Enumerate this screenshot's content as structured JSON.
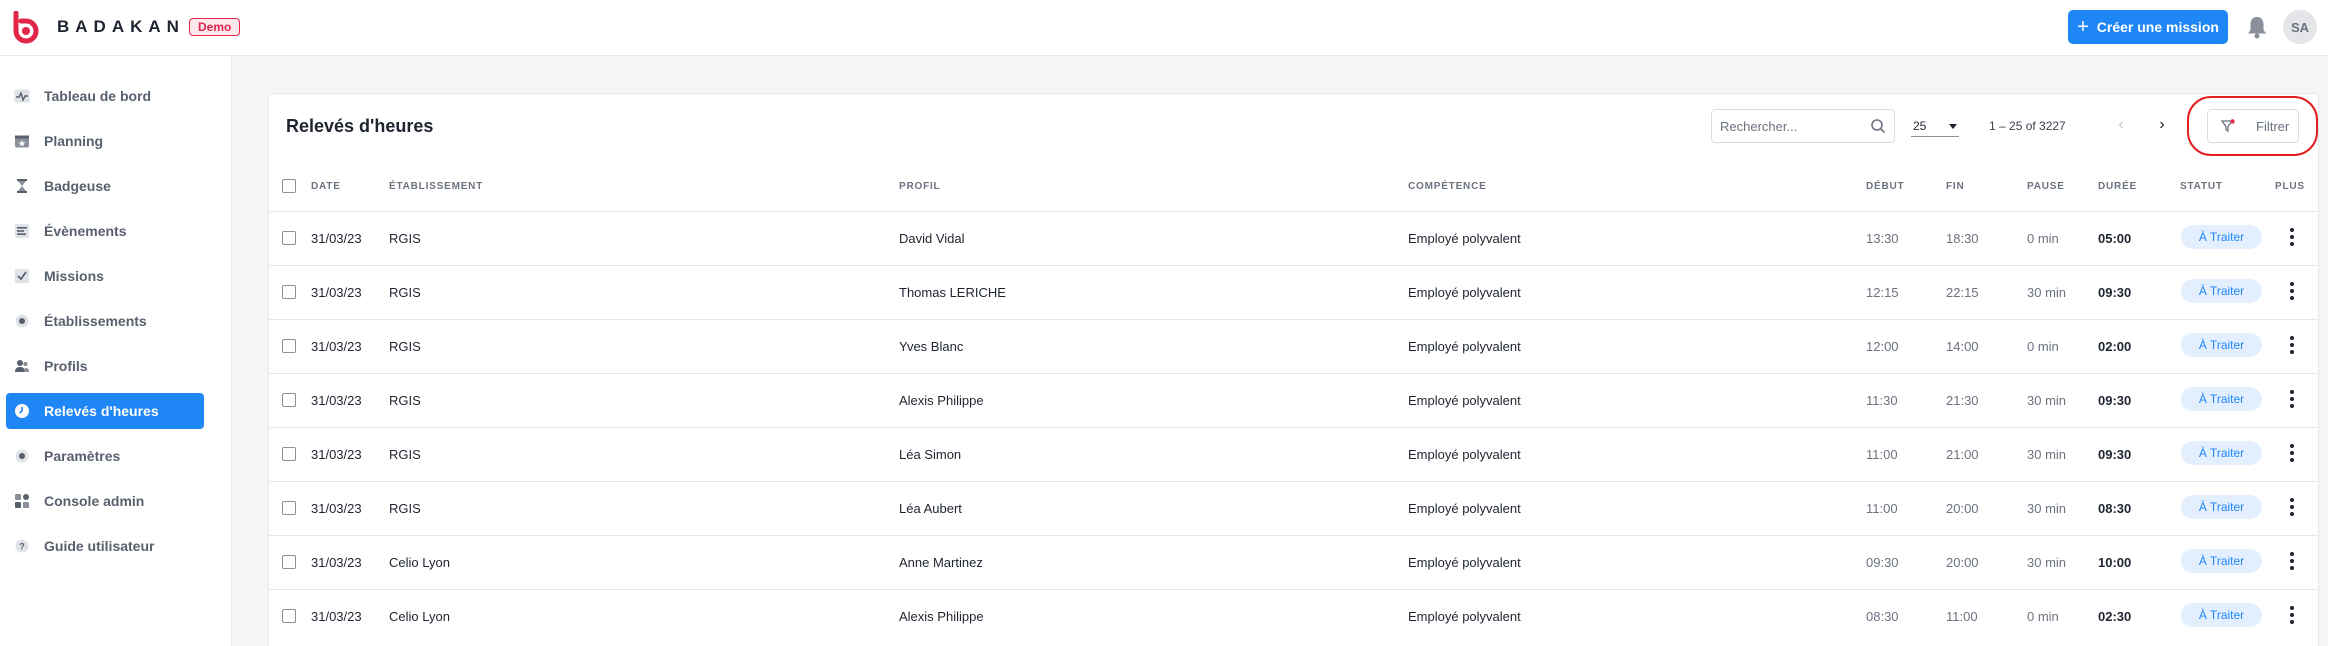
{
  "header": {
    "brand": "BADAKAN",
    "badge": "Demo",
    "create_button": "Créer une mission",
    "avatar_initials": "SA",
    "accent_color": "#1f87f5",
    "logo_color": "#e2264a"
  },
  "sidebar": {
    "items": [
      {
        "label": "Tableau de bord",
        "icon": "pulse-icon"
      },
      {
        "label": "Planning",
        "icon": "calendar-icon"
      },
      {
        "label": "Badgeuse",
        "icon": "hourglass-icon"
      },
      {
        "label": "Évènements",
        "icon": "list-icon"
      },
      {
        "label": "Missions",
        "icon": "checklist-icon"
      },
      {
        "label": "Établissements",
        "icon": "building-icon"
      },
      {
        "label": "Profils",
        "icon": "users-icon"
      },
      {
        "label": "Relevés d'heures",
        "icon": "clock-icon",
        "active": true
      },
      {
        "label": "Paramètres",
        "icon": "gear-icon"
      },
      {
        "label": "Console admin",
        "icon": "grid-icon"
      },
      {
        "label": "Guide utilisateur",
        "icon": "help-icon"
      }
    ]
  },
  "main": {
    "title": "Relevés d'heures",
    "search_placeholder": "Rechercher...",
    "per_page": "25",
    "range": "1 – 25 of 3227",
    "filter_label": "Filtrer",
    "columns": {
      "date": "DATE",
      "etablissement": "ÉTABLISSEMENT",
      "profil": "PROFIL",
      "competence": "COMPÉTENCE",
      "debut": "DÉBUT",
      "fin": "FIN",
      "pause": "PAUSE",
      "duree": "DURÉE",
      "statut": "STATUT",
      "plus": "PLUS"
    },
    "rows": [
      {
        "date": "31/03/23",
        "etablissement": "RGIS",
        "profil": "David Vidal",
        "competence": "Employé polyvalent",
        "debut": "13:30",
        "fin": "18:30",
        "pause": "0 min",
        "duree": "05:00",
        "statut": "À Traiter"
      },
      {
        "date": "31/03/23",
        "etablissement": "RGIS",
        "profil": "Thomas LERICHE",
        "competence": "Employé polyvalent",
        "debut": "12:15",
        "fin": "22:15",
        "pause": "30 min",
        "duree": "09:30",
        "statut": "À Traiter"
      },
      {
        "date": "31/03/23",
        "etablissement": "RGIS",
        "profil": "Yves Blanc",
        "competence": "Employé polyvalent",
        "debut": "12:00",
        "fin": "14:00",
        "pause": "0 min",
        "duree": "02:00",
        "statut": "À Traiter"
      },
      {
        "date": "31/03/23",
        "etablissement": "RGIS",
        "profil": "Alexis Philippe",
        "competence": "Employé polyvalent",
        "debut": "11:30",
        "fin": "21:30",
        "pause": "30 min",
        "duree": "09:30",
        "statut": "À Traiter"
      },
      {
        "date": "31/03/23",
        "etablissement": "RGIS",
        "profil": "Léa Simon",
        "competence": "Employé polyvalent",
        "debut": "11:00",
        "fin": "21:00",
        "pause": "30 min",
        "duree": "09:30",
        "statut": "À Traiter"
      },
      {
        "date": "31/03/23",
        "etablissement": "RGIS",
        "profil": "Léa Aubert",
        "competence": "Employé polyvalent",
        "debut": "11:00",
        "fin": "20:00",
        "pause": "30 min",
        "duree": "08:30",
        "statut": "À Traiter"
      },
      {
        "date": "31/03/23",
        "etablissement": "Celio Lyon",
        "profil": "Anne Martinez",
        "competence": "Employé polyvalent",
        "debut": "09:30",
        "fin": "20:00",
        "pause": "30 min",
        "duree": "10:00",
        "statut": "À Traiter"
      },
      {
        "date": "31/03/23",
        "etablissement": "Celio Lyon",
        "profil": "Alexis Philippe",
        "competence": "Employé polyvalent",
        "debut": "08:30",
        "fin": "11:00",
        "pause": "0 min",
        "duree": "02:30",
        "statut": "À Traiter"
      }
    ]
  }
}
